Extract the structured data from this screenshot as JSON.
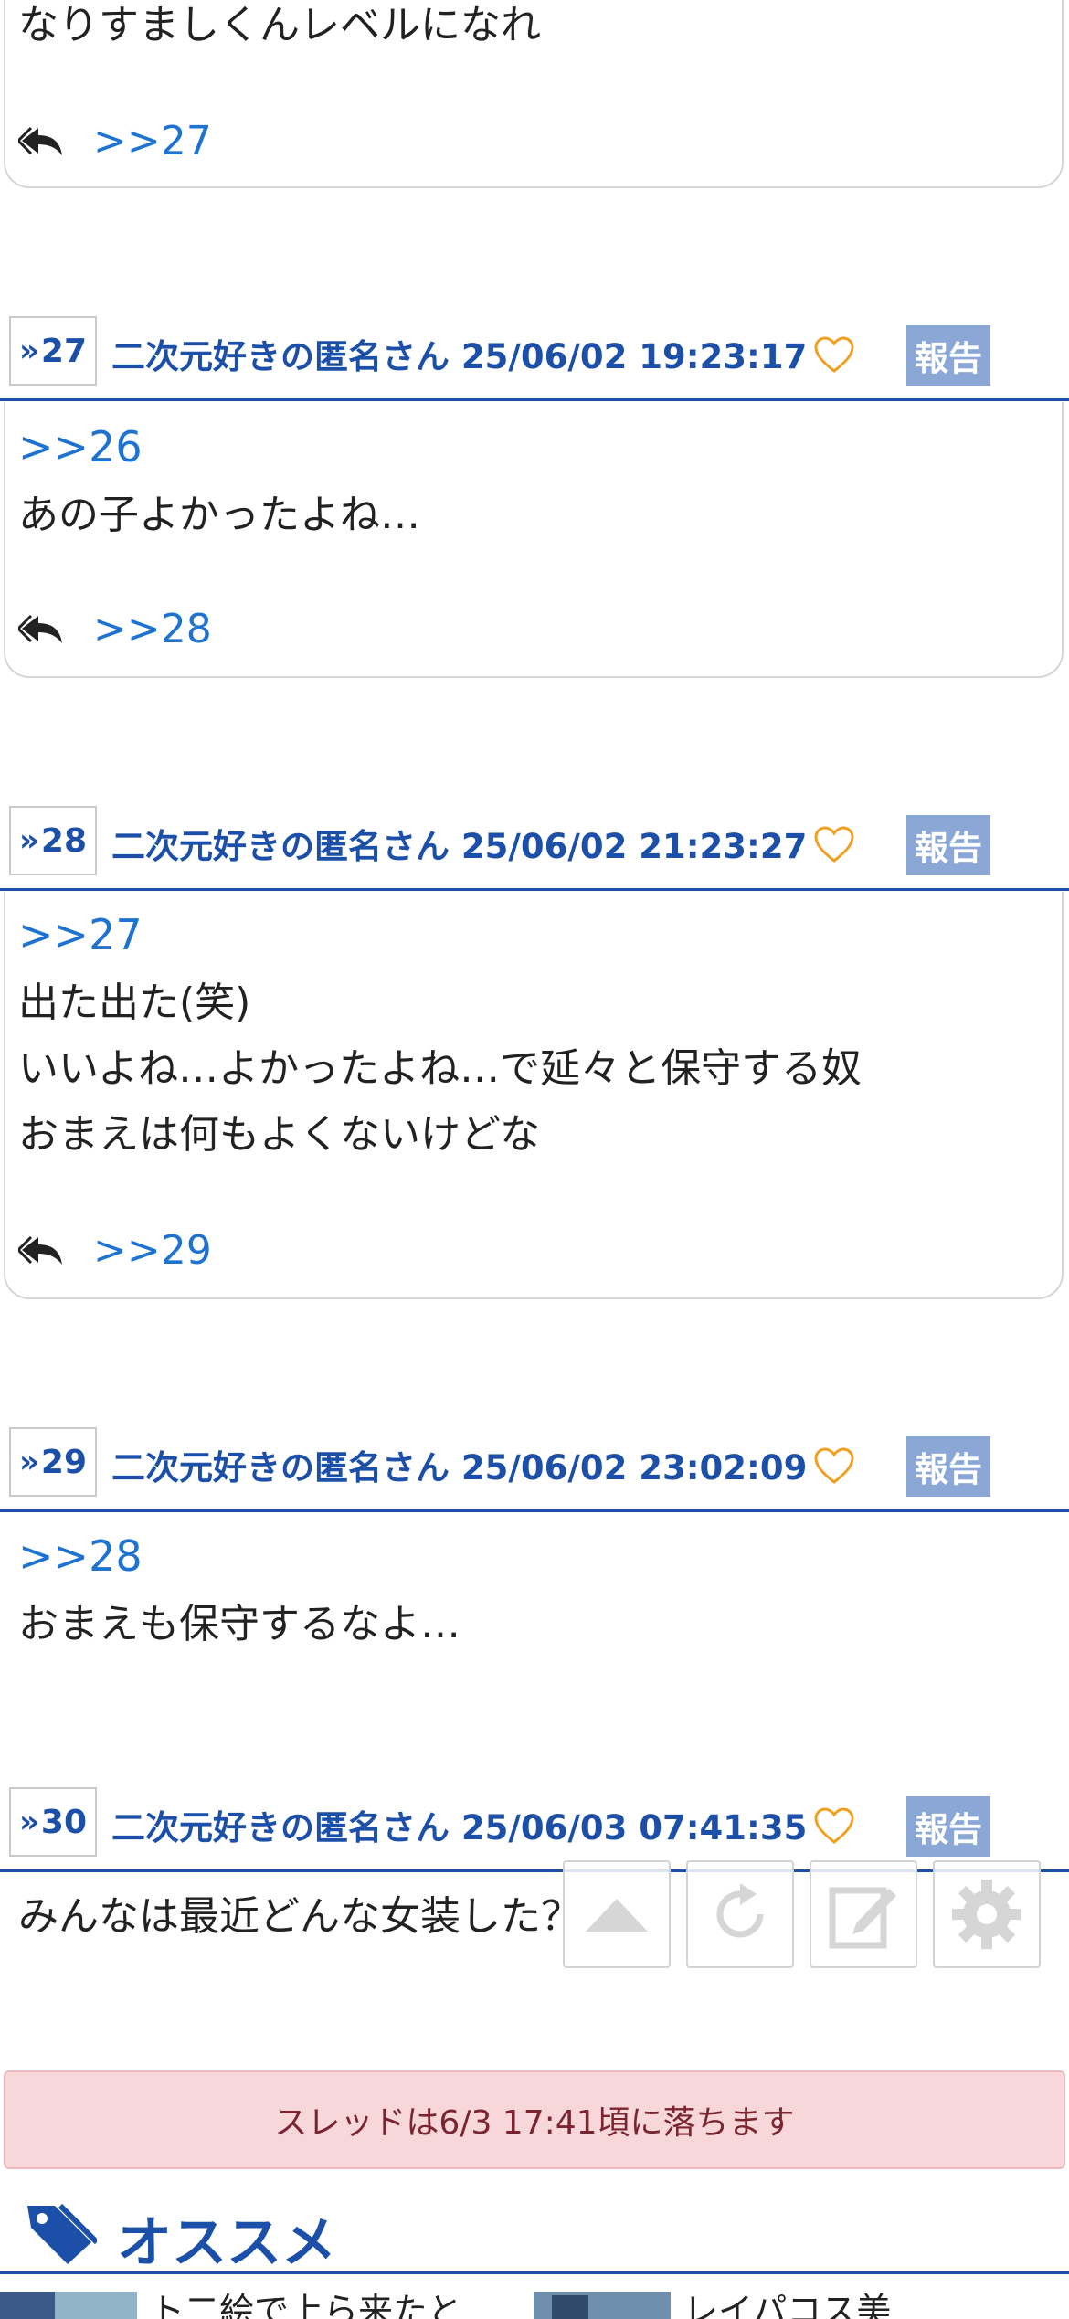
{
  "posts": [
    {
      "text": "なりすましくんレベルになれ",
      "reply": ">>27"
    },
    {
      "num": "27",
      "meta": "二次元好きの匿名さん 25/06/02 19:23:17",
      "report": "報告",
      "anchor": ">>26",
      "text": "あの子よかったよね…",
      "reply": ">>28"
    },
    {
      "num": "28",
      "meta": "二次元好きの匿名さん 25/06/02 21:23:27",
      "report": "報告",
      "anchor": ">>27",
      "text": "出た出た(笑)\nいいよね…よかったよね…で延々と保守する奴\nおまえは何もよくないけどな",
      "reply": ">>29"
    },
    {
      "num": "29",
      "meta": "二次元好きの匿名さん 25/06/02 23:02:09",
      "report": "報告",
      "anchor": ">>28",
      "text": "おまえも保守するなよ…"
    },
    {
      "num": "30",
      "meta": "二次元好きの匿名さん 25/06/03 07:41:35",
      "report": "報告",
      "text": "みんなは最近どんな女装した？"
    }
  ],
  "notice": "スレッドは6/3 17:41頃に落ちます",
  "recommend": {
    "title": "オススメ",
    "items": [
      {
        "text": "ト二絵で上ら来たと"
      },
      {
        "text": "レイパコス美"
      }
    ]
  },
  "colors": {
    "header_blue": "#1b4fa8",
    "link_blue": "#1f73d0",
    "report_bg": "#8aa7d6",
    "heart": "#f0a020",
    "notice_bg": "#f8d7da"
  },
  "icons": [
    "reply-icon",
    "heart-icon",
    "scroll-top-icon",
    "reload-icon",
    "edit-icon",
    "settings-icon",
    "tag-icon"
  ]
}
